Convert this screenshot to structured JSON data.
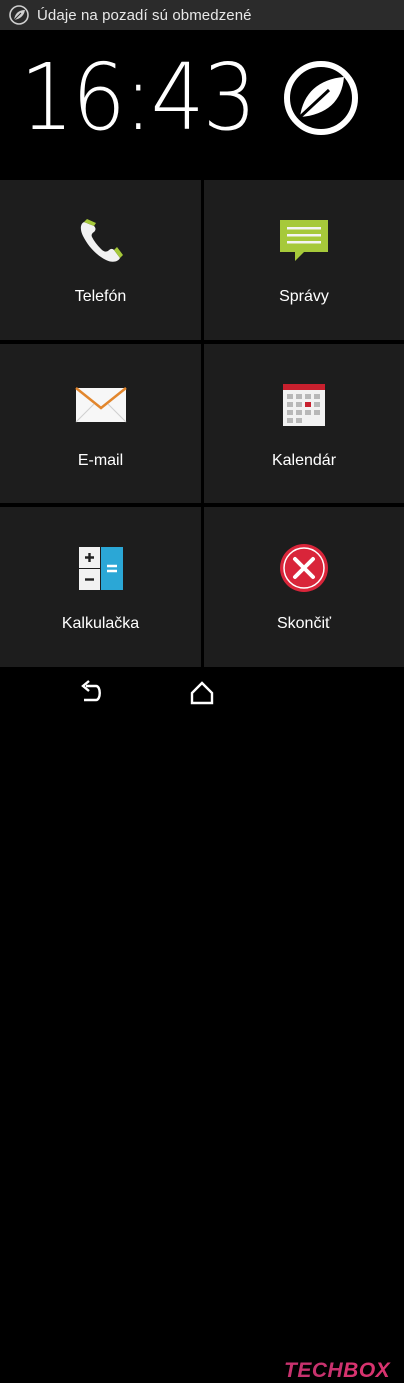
{
  "status_bar": {
    "message": "Údaje na pozadí sú obmedzené",
    "icon": "leaf-icon"
  },
  "clock": {
    "time": "16:43"
  },
  "brand": {
    "icon": "leaf-logo-icon"
  },
  "tiles": [
    {
      "label": "Telefón",
      "icon": "phone-icon"
    },
    {
      "label": "Správy",
      "icon": "message-icon"
    },
    {
      "label": "E-mail",
      "icon": "mail-icon"
    },
    {
      "label": "Kalendár",
      "icon": "calendar-icon"
    },
    {
      "label": "Kalkulačka",
      "icon": "calculator-icon"
    },
    {
      "label": "Skončiť",
      "icon": "exit-icon"
    }
  ],
  "nav": {
    "back_icon": "back-icon",
    "home_icon": "home-icon"
  },
  "watermark": {
    "part_a": "TECH",
    "part_b": "BOX"
  },
  "colors": {
    "tile_background": "#1d1d1d",
    "status_background": "#2b2b2b",
    "accent_green": "#a6c93a",
    "exit_red": "#d9253a",
    "watermark_pink": "#c8326e"
  }
}
